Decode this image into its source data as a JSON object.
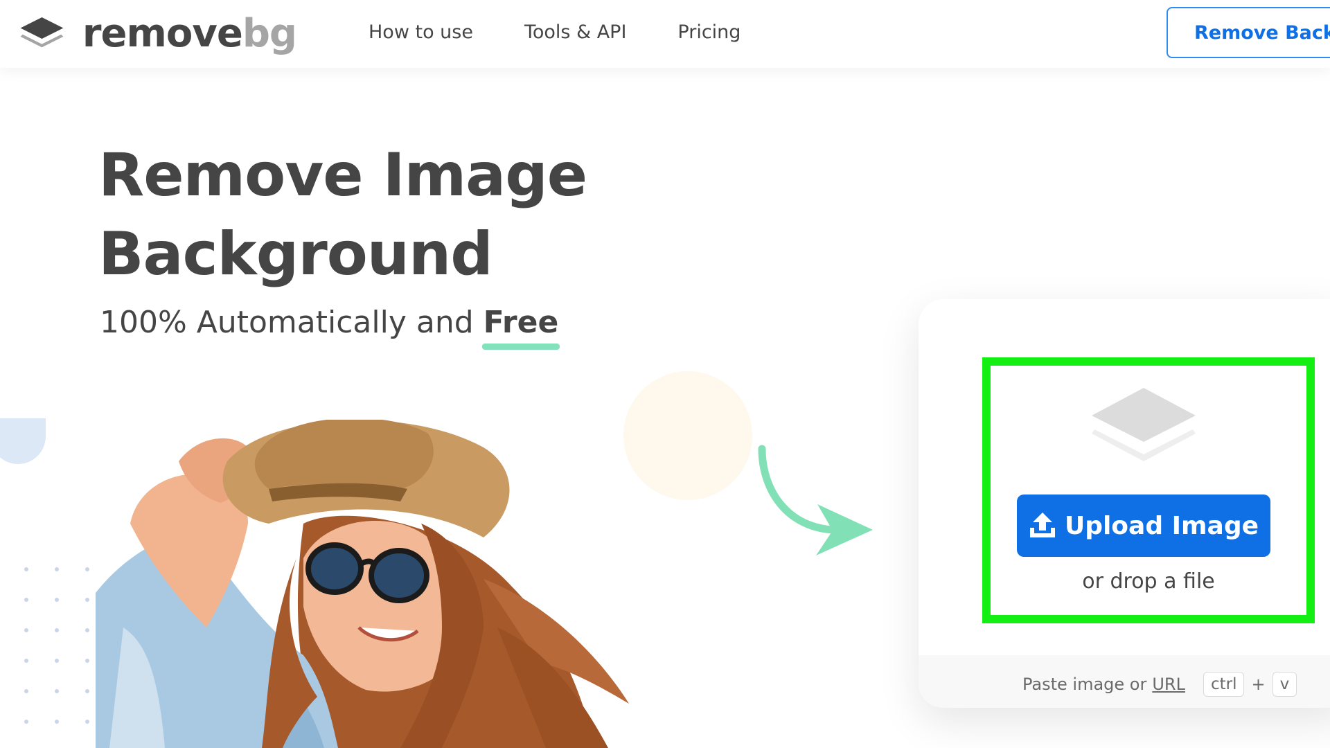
{
  "header": {
    "logo": {
      "name": "removebg-logo-icon",
      "text_remove": "remove",
      "text_bg": "bg"
    },
    "nav": [
      {
        "label": "How to use"
      },
      {
        "label": "Tools & API"
      },
      {
        "label": "Pricing"
      }
    ],
    "cta_label": "Remove Background"
  },
  "hero": {
    "title_line1": "Remove Image",
    "title_line2": "Background",
    "subtitle_prefix": "100% Automatically and",
    "subtitle_emphasis": "Free"
  },
  "photo": {
    "icon": "woman-with-hat-photo"
  },
  "upload": {
    "button_label": "Upload Image",
    "drop_text": "or drop a file",
    "paste_text": "Paste image or",
    "url_label": "URL",
    "shortcut_key1": "ctrl",
    "shortcut_plus": "+",
    "shortcut_key2": "v"
  },
  "colors": {
    "accent": "#0f70e6",
    "text": "#454545",
    "highlight": "#13ef13",
    "underline": "#83e2bb",
    "arrow": "#82e0b7"
  }
}
